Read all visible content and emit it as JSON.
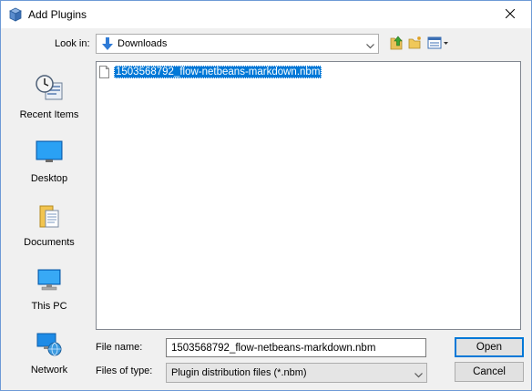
{
  "window": {
    "title": "Add Plugins",
    "title_icon": "netbeans-cube-icon",
    "close_icon": "close-icon"
  },
  "lookin": {
    "label": "Look in:",
    "value": "Downloads"
  },
  "toolbar": {
    "up_icon": "up-one-level-icon",
    "new_folder_icon": "create-new-folder-icon",
    "view_icon": "view-menu-icon"
  },
  "places": [
    {
      "label": "Recent Items",
      "icon": "recent-items-icon"
    },
    {
      "label": "Desktop",
      "icon": "desktop-icon"
    },
    {
      "label": "Documents",
      "icon": "documents-icon"
    },
    {
      "label": "This PC",
      "icon": "this-pc-icon"
    },
    {
      "label": "Network",
      "icon": "network-icon"
    }
  ],
  "files": [
    {
      "name": "1503568792_flow-netbeans-markdown.nbm",
      "selected": true
    }
  ],
  "filename": {
    "label": "File name:",
    "value": "1503568792_flow-netbeans-markdown.nbm"
  },
  "filetype": {
    "label": "Files of type:",
    "value": "Plugin distribution files (*.nbm)"
  },
  "buttons": {
    "open": "Open",
    "cancel": "Cancel"
  },
  "colors": {
    "selection": "#0078d7",
    "border": "#6d9ad6",
    "background": "#f0f0f0"
  }
}
